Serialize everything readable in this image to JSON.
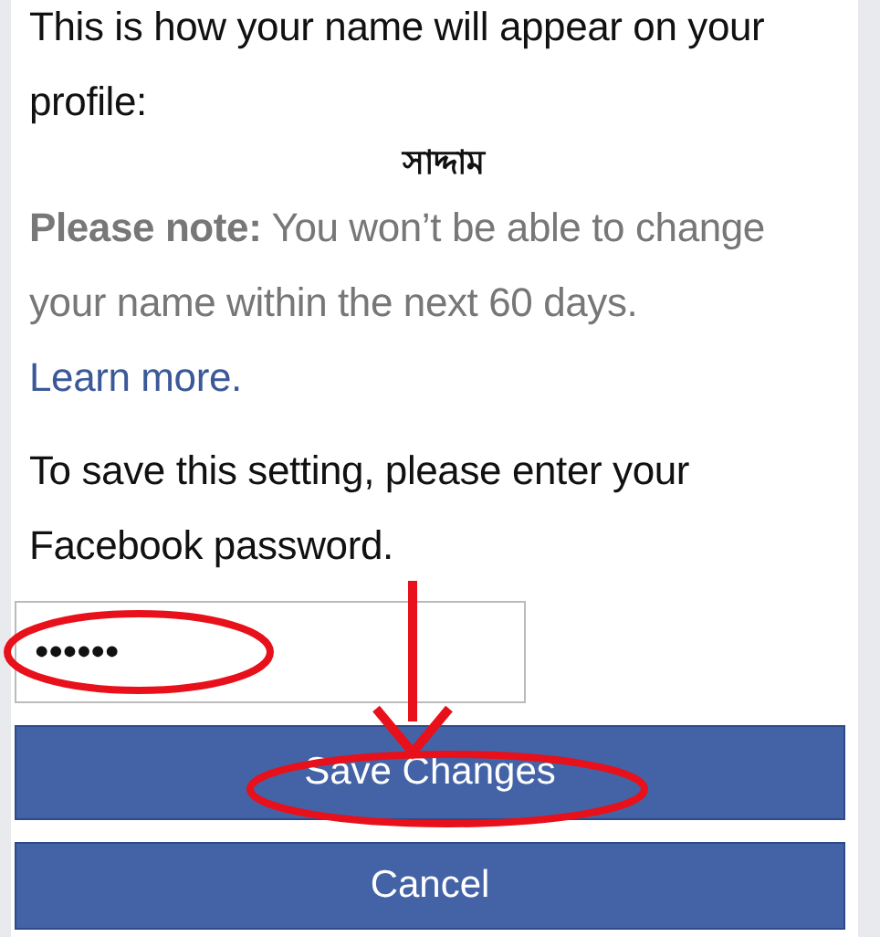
{
  "intro": "This is how your name will appear on your profile:",
  "display_name": "সাদ্দাম",
  "note": {
    "label": "Please note:",
    "text": "You won’t be able to change your name within the next 60 days.",
    "link": "Learn more."
  },
  "password_prompt": "To save this setting, please enter your Facebook password.",
  "password_field": {
    "value": "••••••"
  },
  "buttons": [
    {
      "label": "Save Changes",
      "kind": "primary"
    },
    {
      "label": "Cancel",
      "kind": "secondary"
    }
  ]
}
